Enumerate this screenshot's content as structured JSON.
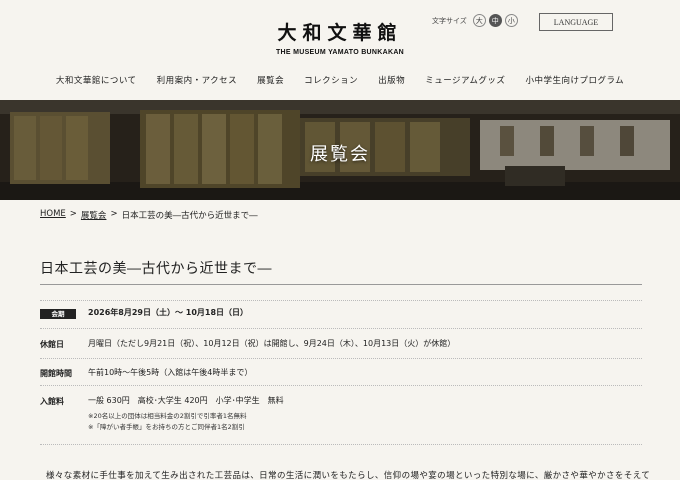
{
  "header": {
    "logo_jp": "大和文華館",
    "logo_en": "THE MUSEUM YAMATO BUNKAKAN",
    "fontsize_label": "文字サイズ",
    "fontsize_options": [
      "大",
      "中",
      "小"
    ],
    "language_label": "LANGUAGE"
  },
  "nav": {
    "items": [
      "大和文華館について",
      "利用案内・アクセス",
      "展覧会",
      "コレクション",
      "出版物",
      "ミュージアムグッズ",
      "小中学生向けプログラム"
    ]
  },
  "hero": {
    "title": "展覧会"
  },
  "breadcrumb": {
    "home": "HOME",
    "sep": ">",
    "exhibitions": "展覧会",
    "current": "日本工芸の美―古代から近世まで―"
  },
  "page": {
    "title": "日本工芸の美―古代から近世まで―"
  },
  "info": {
    "period_label": "会期",
    "period_value": "2026年8月29日（土）～ 10月18日（日）",
    "closed_label": "休館日",
    "closed_value": "月曜日（ただし9月21日（祝）、10月12日（祝）は開館し、9月24日（木）、10月13日（火）が休館）",
    "hours_label": "開館時間",
    "hours_value": "午前10時～午後5時（入館は午後4時半まで）",
    "fee_label": "入館料",
    "fee_value": "一般 630円　高校･大学生 420円　小学･中学生　無料",
    "fee_note1": "※20名以上の団体は相当料金の2割引で引率者1名無料",
    "fee_note2": "※「障がい者手帳」をお持ちの方とご同伴者1名2割引"
  },
  "body": {
    "text": "様々な素材に手仕事を加えて生み出された工芸品は、日常の生活に潤いをもたらし、信仰の場や宴の場といった特別な場に、厳かさや華やかさをそえて"
  }
}
